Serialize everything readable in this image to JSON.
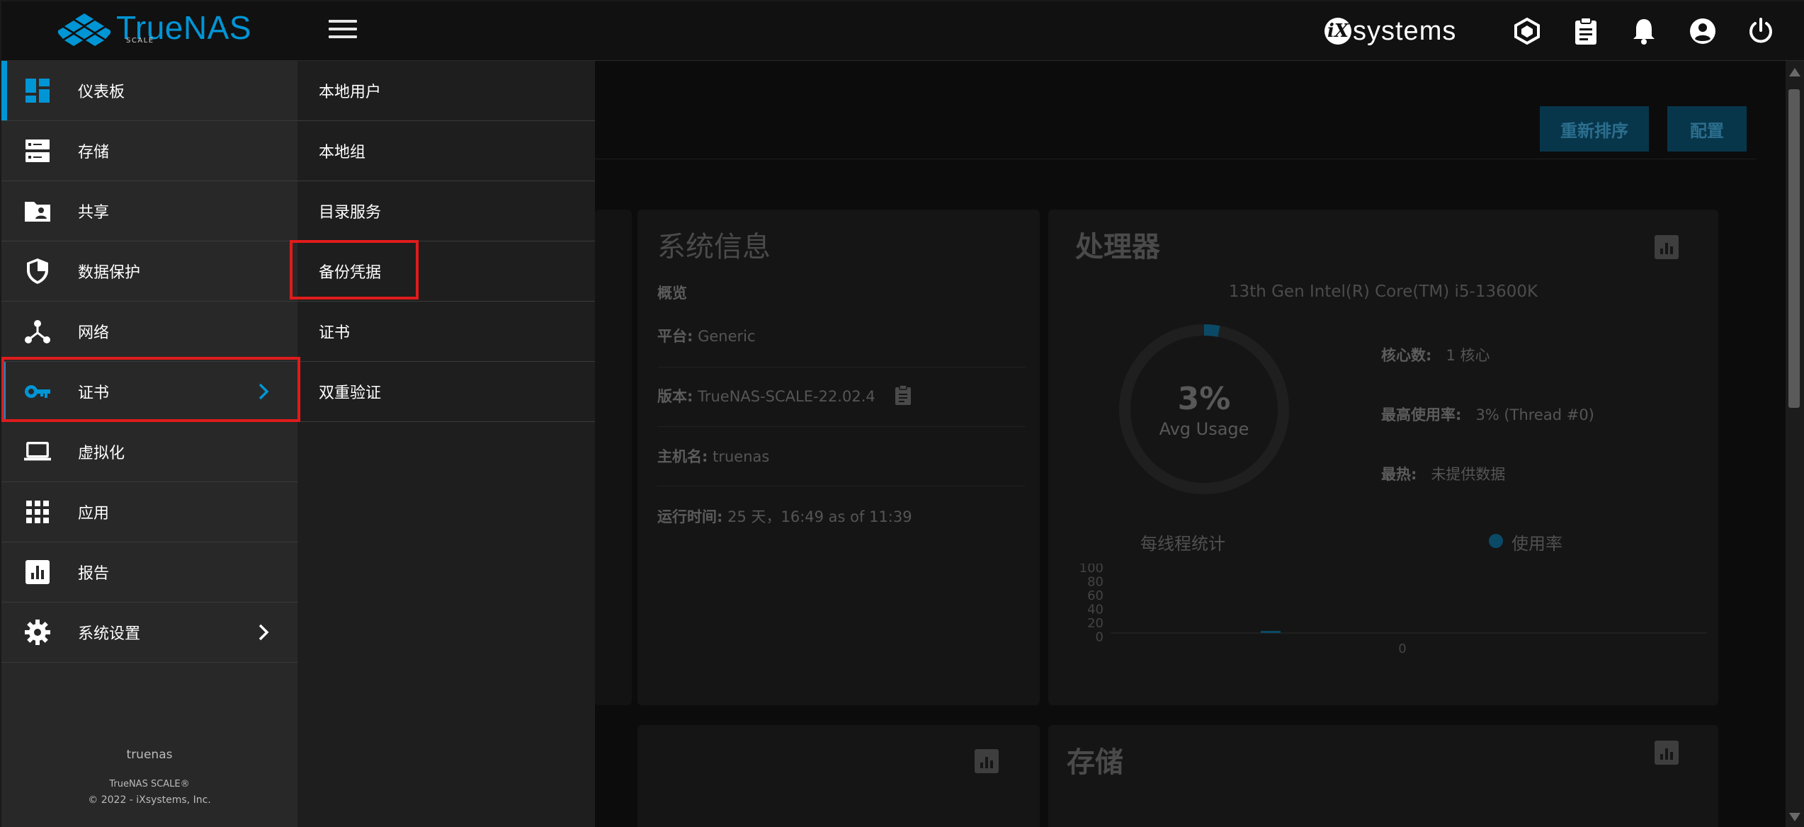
{
  "brand": {
    "name": "TrueNAS",
    "edition": "SCALE",
    "vendor_text": "systems",
    "vendor_mark": "iX"
  },
  "colors": {
    "accent": "#0095d5",
    "highlight": "#e01b1b",
    "sidebar_bg": "#282828",
    "submenu_bg": "#1e1e1e"
  },
  "topbar_icons": [
    "truecommand-icon",
    "clipboard-icon",
    "bell-icon",
    "account-icon",
    "power-icon"
  ],
  "sidebar": {
    "items": [
      {
        "label": "仪表板",
        "icon": "dashboard-icon"
      },
      {
        "label": "存储",
        "icon": "storage-icon"
      },
      {
        "label": "共享",
        "icon": "share-folder-icon"
      },
      {
        "label": "数据保护",
        "icon": "shield-icon"
      },
      {
        "label": "网络",
        "icon": "network-icon"
      },
      {
        "label": "证书",
        "icon": "key-icon"
      },
      {
        "label": "虚拟化",
        "icon": "laptop-icon"
      },
      {
        "label": "应用",
        "icon": "apps-grid-icon"
      },
      {
        "label": "报告",
        "icon": "report-chart-icon"
      },
      {
        "label": "系统设置",
        "icon": "gear-icon"
      }
    ],
    "hostname": "truenas",
    "product": "TrueNAS SCALE®",
    "copyright": "© 2022 - iXsystems, Inc."
  },
  "submenu": {
    "items": [
      {
        "label": "本地用户"
      },
      {
        "label": "本地组"
      },
      {
        "label": "目录服务"
      },
      {
        "label": "备份凭据"
      },
      {
        "label": "证书"
      },
      {
        "label": "双重验证"
      }
    ]
  },
  "main": {
    "reorder_button": "重新排序",
    "configure_button": "配置",
    "sysinfo": {
      "title": "系统信息",
      "overview": "概览",
      "platform_label": "平台:",
      "platform_value": "Generic",
      "version_label": "版本:",
      "version_value": "TrueNAS-SCALE-22.02.4",
      "hostname_label": "主机名:",
      "hostname_value": "truenas",
      "uptime_label": "运行时间:",
      "uptime_value": "25 天，16:49 as of 11:39"
    },
    "cpu": {
      "title": "处理器",
      "model": "13th Gen Intel(R) Core(TM) i5-13600K",
      "usage_pct": "3%",
      "usage_label": "Avg Usage",
      "usage_value": 3,
      "cores_label": "核心数:",
      "cores_value": "1 核心",
      "max_label": "最高使用率:",
      "max_value": "3%  (Thread #0)",
      "hottest_label": "最热:",
      "hottest_value": "未提供数据",
      "thread_stats": "每线程统计",
      "legend_usage": "使用率",
      "yticks": [
        "100",
        "80",
        "60",
        "40",
        "20",
        "0"
      ],
      "xtick": "0"
    },
    "storage": {
      "title": "存储"
    }
  }
}
